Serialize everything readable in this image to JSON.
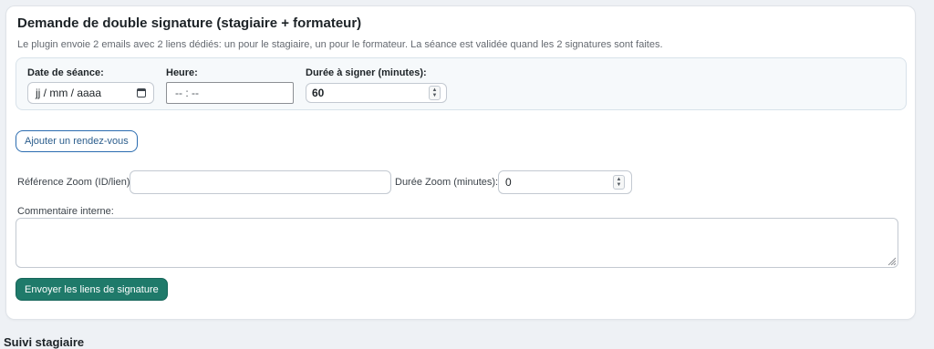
{
  "section": {
    "title": "Demande de double signature (stagiaire + formateur)",
    "description": "Le plugin envoie 2 emails avec 2 liens dédiés: un pour le stagiaire, un pour le formateur. La séance est validée quand les 2 signatures sont faites."
  },
  "session": {
    "date_label": "Date de séance:",
    "date_placeholder": "jj / mm / aaaa",
    "time_label": "Heure:",
    "time_placeholder": "-- : --",
    "duration_label": "Durée à signer (minutes):",
    "duration_value": "60"
  },
  "add_appointment_label": "Ajouter un rendez-vous",
  "zoom": {
    "ref_label": "Référence Zoom (ID/lien):",
    "ref_value": "",
    "duration_label": "Durée Zoom (minutes):",
    "duration_value": "0"
  },
  "comment": {
    "label": "Commentaire interne:",
    "value": ""
  },
  "submit_label": "Envoyer les liens de signature",
  "next_section_title": "Suivi stagiaire",
  "colors": {
    "primary_button": "#1f7a6a",
    "outline_button": "#2b6cb0",
    "panel_bg": "#f6f9fb"
  }
}
